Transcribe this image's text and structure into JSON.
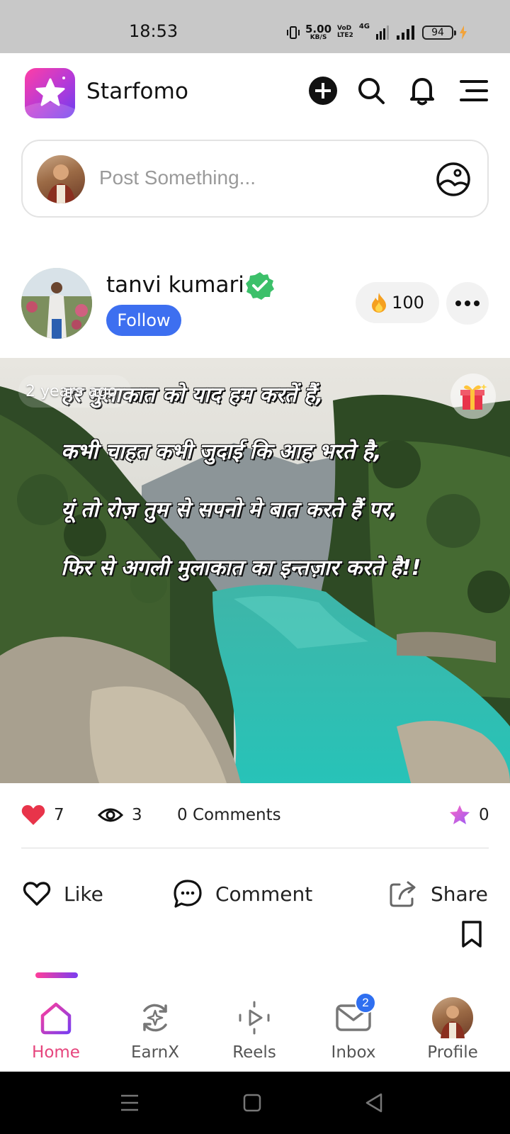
{
  "status_bar": {
    "time": "18:53",
    "net_speed": "5.00",
    "net_unit": "KB/S",
    "volte_top": "VoD",
    "volte_bottom": "LTE2",
    "network": "4G",
    "battery": "94"
  },
  "header": {
    "app_name": "Starfomo",
    "icons": [
      "add-icon",
      "search-icon",
      "bell-icon",
      "menu-icon"
    ]
  },
  "composer": {
    "placeholder": "Post Something..."
  },
  "post": {
    "username": "tanvi kumari",
    "follow_label": "Follow",
    "fire_count": "100",
    "time_ago": "2 years ago",
    "poem_lines": [
      "हर मुलाकात को याद हम करतें हैं,",
      "कभी चाहत कभी जुदाई कि आह भरते है,",
      "यूं तो रोज़ तुम से सपनो मे बात करते हैं पर,",
      "फिर से अगली मुलाकात का इन्तज़ार करते है!!"
    ],
    "likes": "7",
    "views": "3",
    "comments": "0 Comments",
    "stars": "0"
  },
  "actions": {
    "like": "Like",
    "comment": "Comment",
    "share": "Share"
  },
  "bottom_nav": {
    "items": [
      {
        "label": "Home",
        "icon": "home-icon",
        "active": true
      },
      {
        "label": "EarnX",
        "icon": "earnx-icon",
        "active": false
      },
      {
        "label": "Reels",
        "icon": "reels-icon",
        "active": false
      },
      {
        "label": "Inbox",
        "icon": "inbox-icon",
        "active": false,
        "badge": "2"
      },
      {
        "label": "Profile",
        "icon": "avatar",
        "active": false
      }
    ]
  },
  "colors": {
    "accent_blue": "#3d6ff0",
    "active_pink": "#e6457d",
    "like_red": "#e8344a"
  }
}
